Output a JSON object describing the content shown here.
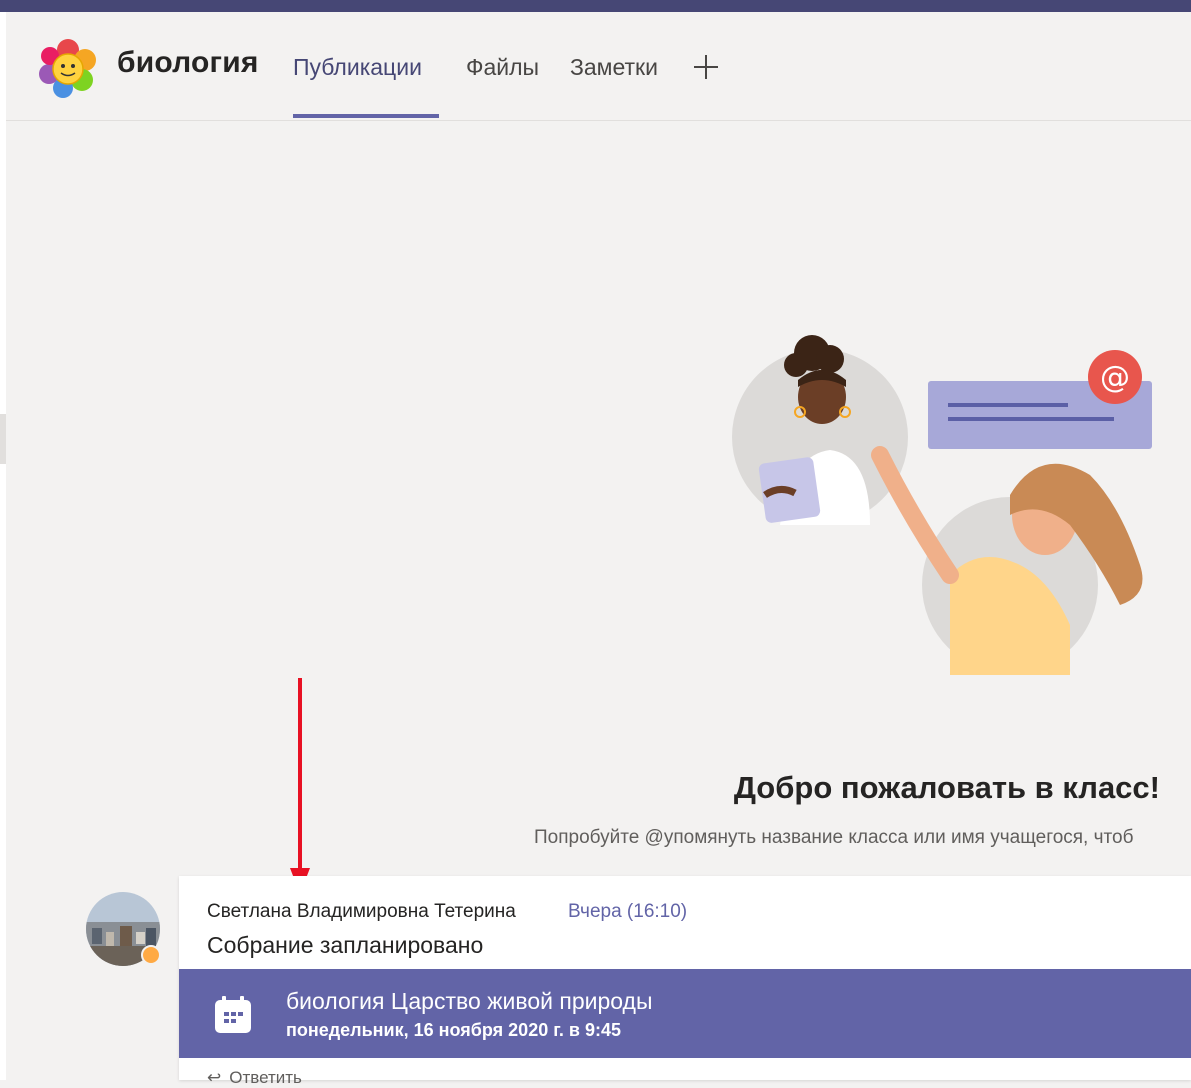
{
  "header": {
    "team_name": "биология",
    "tabs": [
      {
        "label": "Публикации",
        "active": true
      },
      {
        "label": "Файлы",
        "active": false
      },
      {
        "label": "Заметки",
        "active": false
      }
    ],
    "add_tab_icon": "plus-icon",
    "logo_icon": "school-flower-logo"
  },
  "welcome": {
    "title": "Добро пожаловать в класс!",
    "subtitle": "Попробуйте @упомянуть название класса или имя учащегося, чтоб"
  },
  "post": {
    "author": "Светлана Владимировна Тетерина",
    "time": "Вчера (16:10)",
    "text": "Собрание запланировано",
    "presence_status": "away",
    "meeting": {
      "title": "биология Царство живой природы",
      "date": "понедельник, 16 ноября 2020 г. в 9:45",
      "icon": "calendar-icon"
    },
    "reply_label": "Ответить",
    "reply_icon": "reply-icon"
  },
  "colors": {
    "accent": "#6264a7",
    "topbar": "#464775",
    "background": "#f3f2f1",
    "annotation_arrow": "#e81123",
    "presence_away": "#ffaa44"
  }
}
